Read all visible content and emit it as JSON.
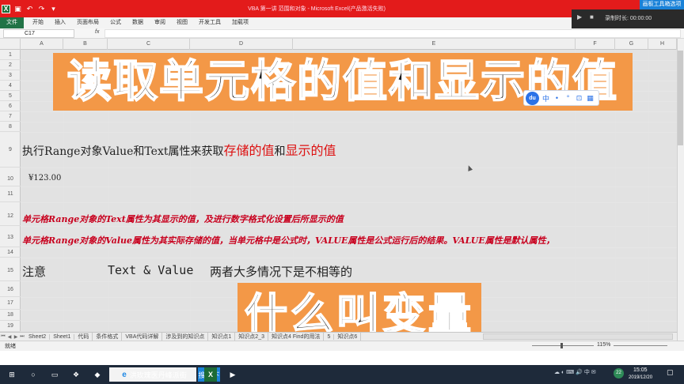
{
  "window": {
    "title": "VBA 第一讲 范围和对象 - Microsoft Excel(产品激活失败)"
  },
  "recorder": {
    "toolbox_label": "画板工具箱选项",
    "time": "录制时长: 00:00:00"
  },
  "ribbon": {
    "file": "文件",
    "tabs": [
      "开始",
      "插入",
      "页面布局",
      "公式",
      "数据",
      "审阅",
      "视图",
      "开发工具",
      "加载项"
    ]
  },
  "formula_bar": {
    "name_box": "C17",
    "fx": "fx",
    "value": ""
  },
  "columns": [
    "A",
    "B",
    "C",
    "D",
    "E",
    "F",
    "G",
    "H"
  ],
  "rows": [
    "1",
    "2",
    "3",
    "4",
    "5",
    "6",
    "7",
    "8",
    "9",
    "10",
    "11",
    "12",
    "13",
    "14",
    "15",
    "16",
    "17",
    "18",
    "19"
  ],
  "banner_top": "读取单元格的值和显示的值",
  "banner_bottom": "什么叫变量",
  "ime": {
    "logo": "du",
    "items": [
      "中",
      "•",
      "°",
      "⊡",
      "▦"
    ]
  },
  "line9": {
    "part1": "执行Range对象Value和Text属性来获取",
    "red1": "存储的值",
    "part2": "和",
    "red2": "显示的值"
  },
  "line10": "¥123.00",
  "line12": "单元格Range对象的Text属性为其显示的值，及进行数字格式化设置后所显示的值",
  "line13": "单元格Range对象的Value属性为其实际存储的值，当单元格中是公式时，VALUE属性是公式运行后的结果。VALUE属性是默认属性，",
  "line15": {
    "label": "注意",
    "code": "Text & Value",
    "rest": "两者大多情况下是不相等的"
  },
  "sheet_tabs": [
    "Sheet2",
    "Sheet1",
    "代码",
    "条件格式",
    "VBA代码详解",
    "涉及到的知识点",
    "知识点1",
    "知识点2_3",
    "知识点4 Find的用法",
    "5",
    "知识点6"
  ],
  "status": {
    "ready": "就绪",
    "zoom": "115%"
  },
  "taskbar": {
    "ie_label": "洪玫瑰医丹峰派街",
    "blue_label": "搜一下",
    "excel": "X",
    "time": "15:05",
    "date": "2019/12/20",
    "tray_badge": "22",
    "tray_icons": "☁ ◐ ⌨ 🔊 中 ✉"
  }
}
